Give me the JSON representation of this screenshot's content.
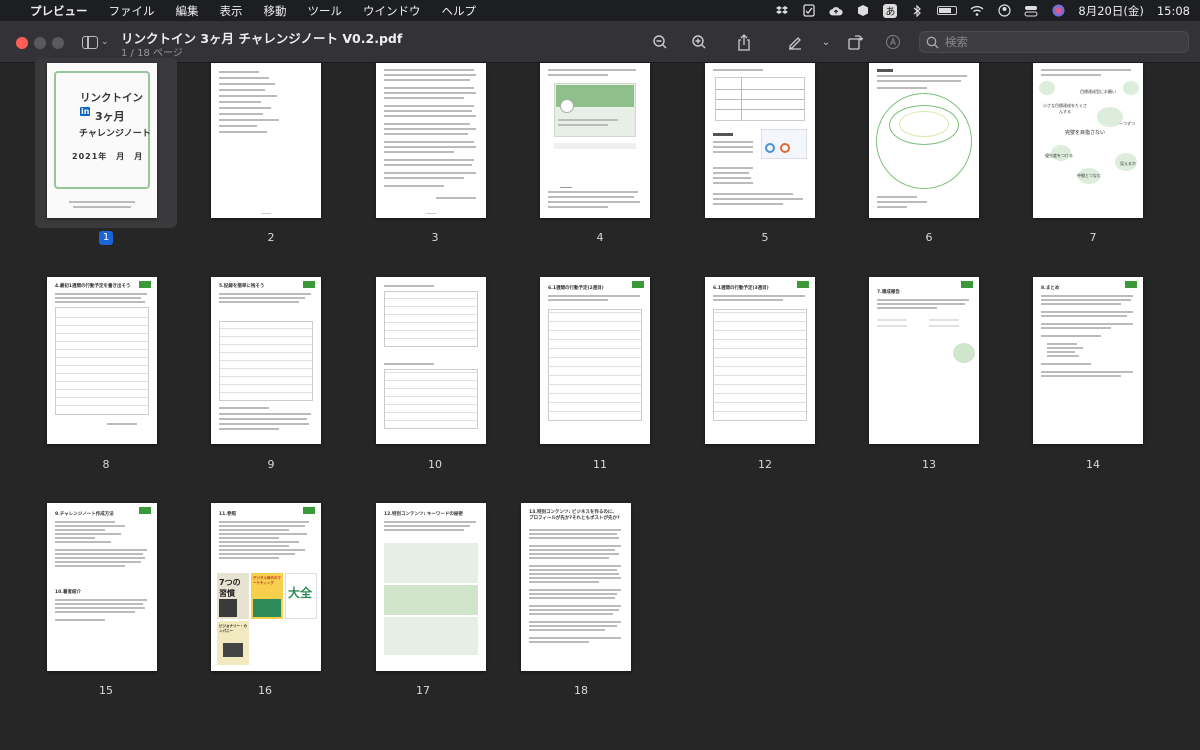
{
  "menubar": {
    "app_name": "プレビュー",
    "items": [
      "ファイル",
      "編集",
      "表示",
      "移動",
      "ツール",
      "ウインドウ",
      "ヘルプ"
    ],
    "ime_label": "あ",
    "date": "8月20日(金)",
    "time": "15:08"
  },
  "window": {
    "title": "リンクトイン 3ヶ月 チャレンジノート V0.2.pdf",
    "subtitle": "1 / 18 ページ",
    "search_placeholder": "検索"
  },
  "cover": {
    "line1": "リンクトイン",
    "line2": "3ヶ月",
    "line3": "チャレンジノート",
    "date_line": "2021年　月　月",
    "li": "in"
  },
  "thumb_texts": {
    "p7_center": "完璧を目指さない",
    "p7_a": "目標達成型にお願い",
    "p7_b": "小さな目標達成をたくさんする",
    "p7_c": "一つずつ",
    "p7_d": "優先度をつける",
    "p7_e": "仲間とつなむ",
    "p7_f": "見えるか",
    "p8_title": "4.最初1週間の行動予定を書き出そう",
    "p9_title": "5.記録を簡単に残そう",
    "p11_title": "6.1週間の行動予定(2週目)",
    "p12_title": "6.1週間の行動予定(3週目)",
    "p13_title": "7.達成報告",
    "p14_title": "8.まとめ",
    "p15_title": "9.チャレンジノート作成方法",
    "p15_sub": "10.著者紹介",
    "p16_title": "11.参照",
    "p17_title": "12.特別コンテンツ: キーワードの秘密",
    "p18_title": "13.特別コンテンツ: ビジネスを作るのに、プロフィールが先か?それともポストが先か?",
    "book1": "7つの習慣",
    "book2": "デジタル時代のマーケティング",
    "book3": "大全",
    "book4": "ビジョナリー・カンパニー"
  },
  "pages": [
    "1",
    "2",
    "3",
    "4",
    "5",
    "6",
    "7",
    "8",
    "9",
    "10",
    "11",
    "12",
    "13",
    "14",
    "15",
    "16",
    "17",
    "18"
  ],
  "colors": {
    "accent": "#1a66d6",
    "green": "#3a9a3a"
  }
}
